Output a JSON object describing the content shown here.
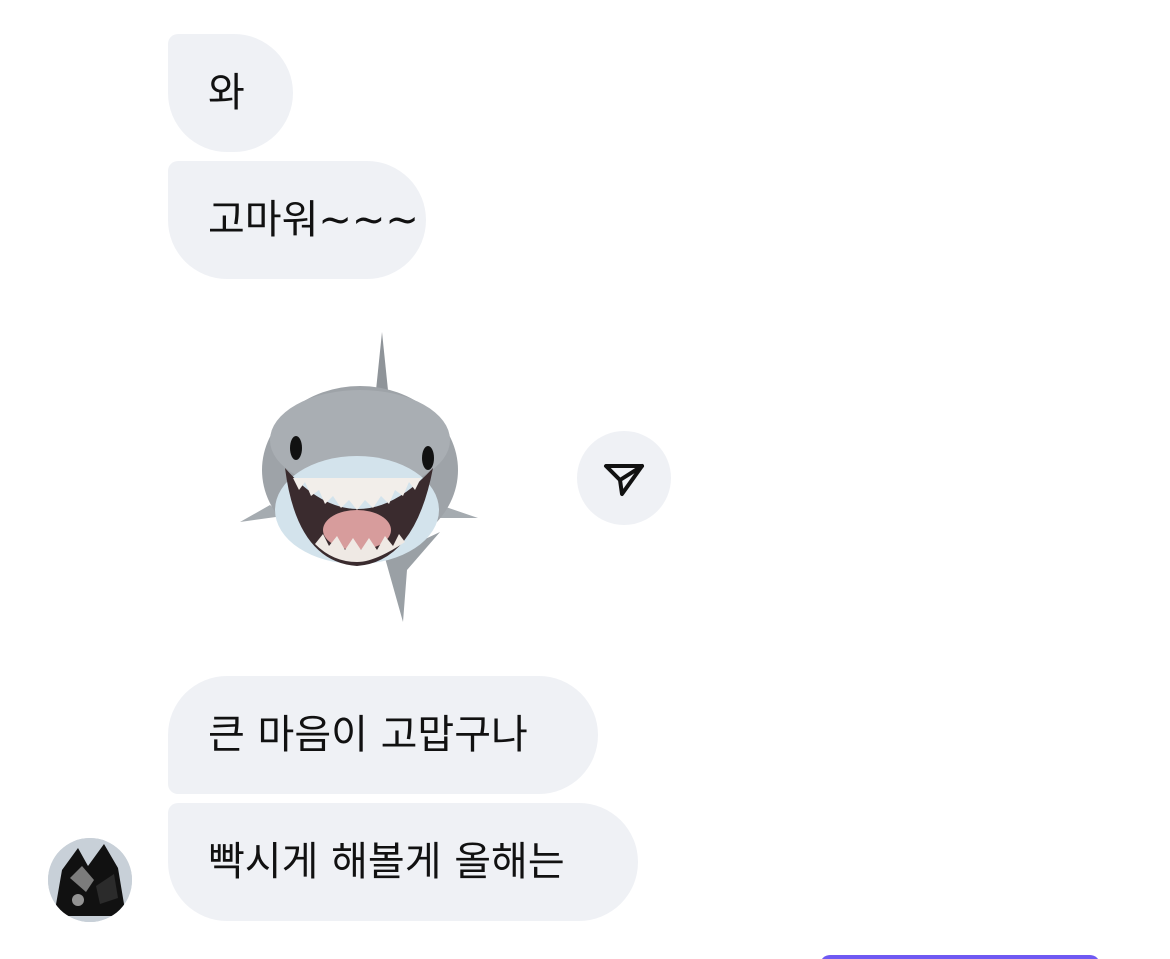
{
  "messages": [
    {
      "text": "와"
    },
    {
      "text": "고마워~~~"
    },
    {
      "sticker": "shark-memoji-sticker"
    },
    {
      "text": "큰 마음이 고맙구나"
    },
    {
      "text": "빡시게 해볼게 올해는"
    }
  ],
  "share_button": {
    "icon": "paper-plane-icon"
  },
  "avatar": {
    "icon": "avatar-image"
  },
  "colors": {
    "bubble_bg": "#eff1f5",
    "text": "#111111",
    "accent": "#6f59f2"
  }
}
